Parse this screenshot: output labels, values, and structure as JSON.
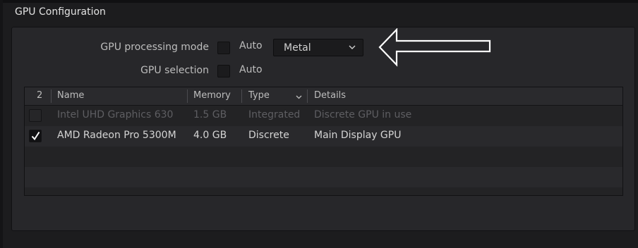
{
  "section": {
    "title": "GPU Configuration"
  },
  "processing": {
    "label": "GPU processing mode",
    "auto_label": "Auto",
    "auto_checked": false,
    "select_value": "Metal"
  },
  "selection": {
    "label": "GPU selection",
    "auto_label": "Auto",
    "auto_checked": false
  },
  "table": {
    "columns": {
      "count": "2",
      "name": "Name",
      "memory": "Memory",
      "type": "Type",
      "details": "Details"
    },
    "rows": [
      {
        "checked": false,
        "enabled": false,
        "name": "Intel UHD Graphics 630",
        "memory": "1.5 GB",
        "type": "Integrated",
        "details": "Discrete GPU in use"
      },
      {
        "checked": true,
        "enabled": true,
        "name": "AMD Radeon Pro 5300M",
        "memory": "4.0 GB",
        "type": "Discrete",
        "details": "Main Display GPU"
      }
    ]
  },
  "colors": {
    "background": "#1c1c1e",
    "panel": "#27272a",
    "annotation_arrow": "#ffffff"
  },
  "icons": {
    "select_chevron": "chevron-down-icon",
    "type_sort": "chevron-down-icon",
    "row_check": "checkmark-icon",
    "annotation": "arrow-left-icon"
  }
}
